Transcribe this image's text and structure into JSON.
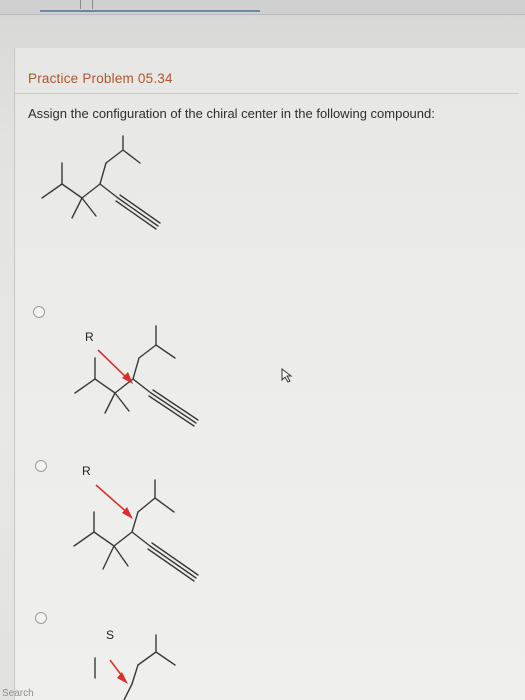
{
  "problem": {
    "title": "Practice Problem 05.34",
    "question": "Assign the configuration of the chiral center in the following compound:"
  },
  "options": [
    {
      "label": "R",
      "selected": false
    },
    {
      "label": "R",
      "selected": false
    },
    {
      "label": "S",
      "selected": false
    }
  ],
  "taskbar": {
    "search_label": "Search"
  },
  "colors": {
    "title": "#b5532a",
    "arrow": "#d8302a",
    "bond": "#3a3a3a"
  }
}
